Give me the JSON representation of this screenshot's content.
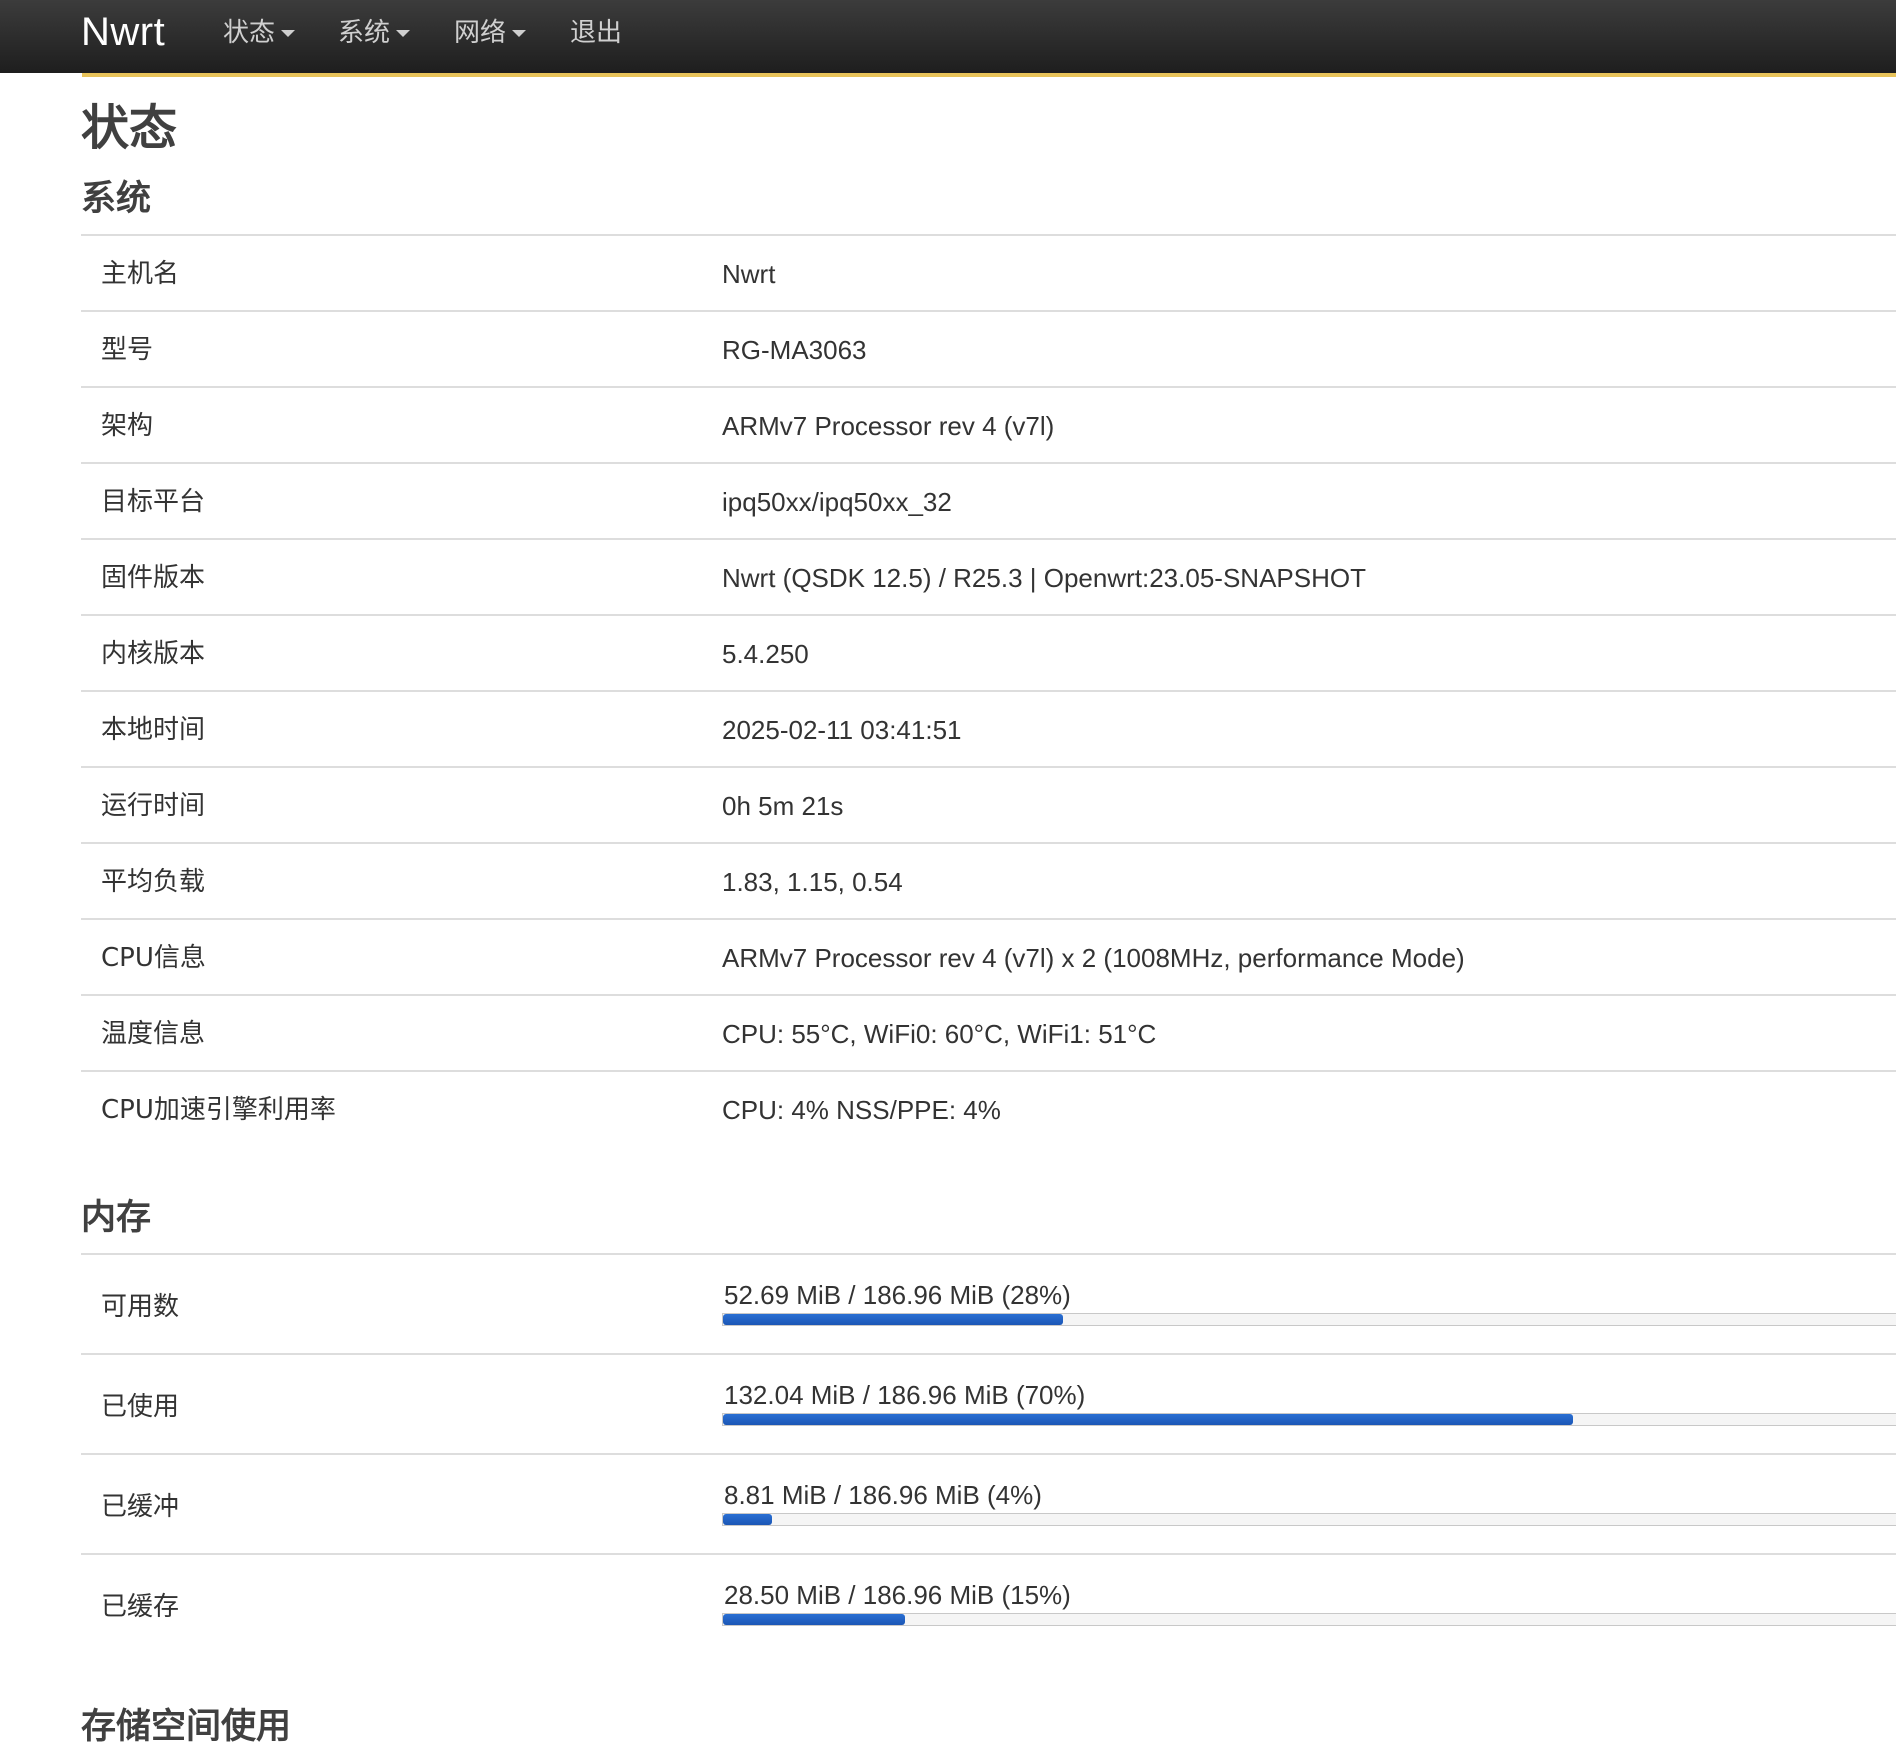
{
  "nav": {
    "brand": "Nwrt",
    "items": [
      {
        "label": "状态",
        "dropdown": true
      },
      {
        "label": "系统",
        "dropdown": true
      },
      {
        "label": "网络",
        "dropdown": true
      },
      {
        "label": "退出",
        "dropdown": false
      }
    ]
  },
  "page": {
    "title": "状态"
  },
  "system": {
    "title": "系统",
    "rows": [
      {
        "label": "主机名",
        "value": "Nwrt"
      },
      {
        "label": "型号",
        "value": "RG-MA3063"
      },
      {
        "label": "架构",
        "value": "ARMv7 Processor rev 4 (v7l)"
      },
      {
        "label": "目标平台",
        "value": "ipq50xx/ipq50xx_32"
      },
      {
        "label": "固件版本",
        "value": "Nwrt (QSDK 12.5) / R25.3 | Openwrt:23.05-SNAPSHOT"
      },
      {
        "label": "内核版本",
        "value": "5.4.250"
      },
      {
        "label": "本地时间",
        "value": "2025-02-11 03:41:51"
      },
      {
        "label": "运行时间",
        "value": "0h 5m 21s"
      },
      {
        "label": "平均负载",
        "value": "1.83, 1.15, 0.54"
      },
      {
        "label": "CPU信息",
        "value": "ARMv7 Processor rev 4 (v7l) x 2 (1008MHz, performance Mode)"
      },
      {
        "label": "温度信息",
        "value": "CPU: 55°C, WiFi0: 60°C, WiFi1: 51°C"
      },
      {
        "label": "CPU加速引擎利用率",
        "value": "CPU: 4% NSS/PPE: 4%"
      }
    ]
  },
  "memory": {
    "title": "内存",
    "rows": [
      {
        "label": "可用数",
        "text": "52.69 MiB / 186.96 MiB (28%)",
        "percent": 28
      },
      {
        "label": "已使用",
        "text": "132.04 MiB / 186.96 MiB (70%)",
        "percent": 70
      },
      {
        "label": "已缓冲",
        "text": "8.81 MiB / 186.96 MiB (4%)",
        "percent": 4
      },
      {
        "label": "已缓存",
        "text": "28.50 MiB / 186.96 MiB (15%)",
        "percent": 15
      }
    ]
  },
  "storage": {
    "title": "存储空间使用"
  },
  "colors": {
    "navbar": "#2b2b2b",
    "accent": "#e8c35a",
    "progress": "#1f5fc4"
  }
}
